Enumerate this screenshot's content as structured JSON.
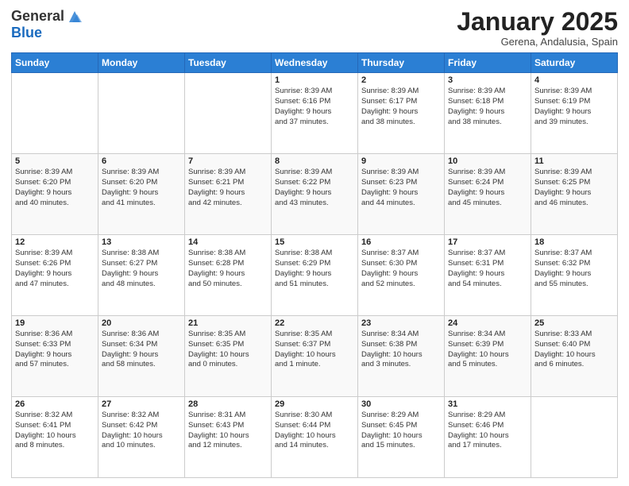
{
  "header": {
    "logo_line1": "General",
    "logo_line2": "Blue",
    "month_title": "January 2025",
    "location": "Gerena, Andalusia, Spain"
  },
  "weekdays": [
    "Sunday",
    "Monday",
    "Tuesday",
    "Wednesday",
    "Thursday",
    "Friday",
    "Saturday"
  ],
  "weeks": [
    [
      {
        "day": "",
        "info": ""
      },
      {
        "day": "",
        "info": ""
      },
      {
        "day": "",
        "info": ""
      },
      {
        "day": "1",
        "info": "Sunrise: 8:39 AM\nSunset: 6:16 PM\nDaylight: 9 hours\nand 37 minutes."
      },
      {
        "day": "2",
        "info": "Sunrise: 8:39 AM\nSunset: 6:17 PM\nDaylight: 9 hours\nand 38 minutes."
      },
      {
        "day": "3",
        "info": "Sunrise: 8:39 AM\nSunset: 6:18 PM\nDaylight: 9 hours\nand 38 minutes."
      },
      {
        "day": "4",
        "info": "Sunrise: 8:39 AM\nSunset: 6:19 PM\nDaylight: 9 hours\nand 39 minutes."
      }
    ],
    [
      {
        "day": "5",
        "info": "Sunrise: 8:39 AM\nSunset: 6:20 PM\nDaylight: 9 hours\nand 40 minutes."
      },
      {
        "day": "6",
        "info": "Sunrise: 8:39 AM\nSunset: 6:20 PM\nDaylight: 9 hours\nand 41 minutes."
      },
      {
        "day": "7",
        "info": "Sunrise: 8:39 AM\nSunset: 6:21 PM\nDaylight: 9 hours\nand 42 minutes."
      },
      {
        "day": "8",
        "info": "Sunrise: 8:39 AM\nSunset: 6:22 PM\nDaylight: 9 hours\nand 43 minutes."
      },
      {
        "day": "9",
        "info": "Sunrise: 8:39 AM\nSunset: 6:23 PM\nDaylight: 9 hours\nand 44 minutes."
      },
      {
        "day": "10",
        "info": "Sunrise: 8:39 AM\nSunset: 6:24 PM\nDaylight: 9 hours\nand 45 minutes."
      },
      {
        "day": "11",
        "info": "Sunrise: 8:39 AM\nSunset: 6:25 PM\nDaylight: 9 hours\nand 46 minutes."
      }
    ],
    [
      {
        "day": "12",
        "info": "Sunrise: 8:39 AM\nSunset: 6:26 PM\nDaylight: 9 hours\nand 47 minutes."
      },
      {
        "day": "13",
        "info": "Sunrise: 8:38 AM\nSunset: 6:27 PM\nDaylight: 9 hours\nand 48 minutes."
      },
      {
        "day": "14",
        "info": "Sunrise: 8:38 AM\nSunset: 6:28 PM\nDaylight: 9 hours\nand 50 minutes."
      },
      {
        "day": "15",
        "info": "Sunrise: 8:38 AM\nSunset: 6:29 PM\nDaylight: 9 hours\nand 51 minutes."
      },
      {
        "day": "16",
        "info": "Sunrise: 8:37 AM\nSunset: 6:30 PM\nDaylight: 9 hours\nand 52 minutes."
      },
      {
        "day": "17",
        "info": "Sunrise: 8:37 AM\nSunset: 6:31 PM\nDaylight: 9 hours\nand 54 minutes."
      },
      {
        "day": "18",
        "info": "Sunrise: 8:37 AM\nSunset: 6:32 PM\nDaylight: 9 hours\nand 55 minutes."
      }
    ],
    [
      {
        "day": "19",
        "info": "Sunrise: 8:36 AM\nSunset: 6:33 PM\nDaylight: 9 hours\nand 57 minutes."
      },
      {
        "day": "20",
        "info": "Sunrise: 8:36 AM\nSunset: 6:34 PM\nDaylight: 9 hours\nand 58 minutes."
      },
      {
        "day": "21",
        "info": "Sunrise: 8:35 AM\nSunset: 6:35 PM\nDaylight: 10 hours\nand 0 minutes."
      },
      {
        "day": "22",
        "info": "Sunrise: 8:35 AM\nSunset: 6:37 PM\nDaylight: 10 hours\nand 1 minute."
      },
      {
        "day": "23",
        "info": "Sunrise: 8:34 AM\nSunset: 6:38 PM\nDaylight: 10 hours\nand 3 minutes."
      },
      {
        "day": "24",
        "info": "Sunrise: 8:34 AM\nSunset: 6:39 PM\nDaylight: 10 hours\nand 5 minutes."
      },
      {
        "day": "25",
        "info": "Sunrise: 8:33 AM\nSunset: 6:40 PM\nDaylight: 10 hours\nand 6 minutes."
      }
    ],
    [
      {
        "day": "26",
        "info": "Sunrise: 8:32 AM\nSunset: 6:41 PM\nDaylight: 10 hours\nand 8 minutes."
      },
      {
        "day": "27",
        "info": "Sunrise: 8:32 AM\nSunset: 6:42 PM\nDaylight: 10 hours\nand 10 minutes."
      },
      {
        "day": "28",
        "info": "Sunrise: 8:31 AM\nSunset: 6:43 PM\nDaylight: 10 hours\nand 12 minutes."
      },
      {
        "day": "29",
        "info": "Sunrise: 8:30 AM\nSunset: 6:44 PM\nDaylight: 10 hours\nand 14 minutes."
      },
      {
        "day": "30",
        "info": "Sunrise: 8:29 AM\nSunset: 6:45 PM\nDaylight: 10 hours\nand 15 minutes."
      },
      {
        "day": "31",
        "info": "Sunrise: 8:29 AM\nSunset: 6:46 PM\nDaylight: 10 hours\nand 17 minutes."
      },
      {
        "day": "",
        "info": ""
      }
    ]
  ]
}
